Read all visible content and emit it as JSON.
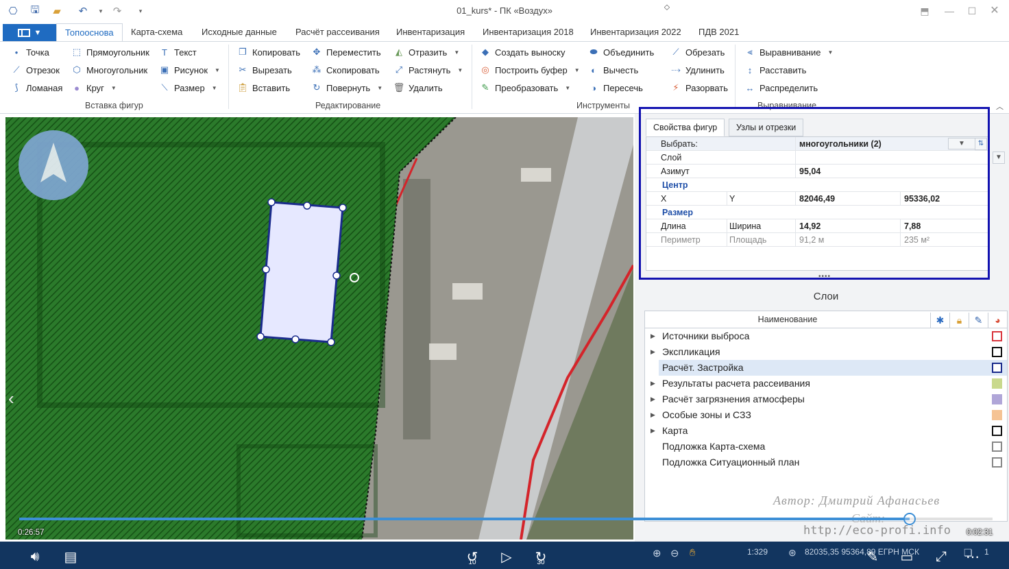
{
  "window": {
    "title": "01_kurs* - ПК «Воздух»",
    "quick_access": [
      "app-icon",
      "save-icon",
      "open-folder-icon",
      "undo-icon",
      "redo-icon",
      "customize-icon"
    ],
    "controls": [
      "ribbon-options-icon",
      "minimize-icon",
      "maximize-icon",
      "close-icon"
    ]
  },
  "tabs": [
    "Топооснова",
    "Карта-схема",
    "Исходные данные",
    "Расчёт рассеивания",
    "Инвентаризация",
    "Инвентаризация 2018",
    "Инвентаризация 2022",
    "ПДВ 2021"
  ],
  "ribbon": {
    "insert": {
      "label": "Вставка фигур",
      "point": "Точка",
      "segment": "Отрезок",
      "polyline": "Ломаная",
      "rectangle": "Прямоугольник",
      "polygon": "Многоугольник",
      "circle": "Круг",
      "text": "Текст",
      "picture": "Рисунок",
      "size": "Размер"
    },
    "edit": {
      "label": "Редактирование",
      "copy": "Копировать",
      "cut": "Вырезать",
      "paste": "Вставить",
      "move": "Переместить",
      "duplicate": "Скопировать",
      "rotate": "Повернуть",
      "mirror": "Отразить",
      "stretch": "Растянуть",
      "delete": "Удалить"
    },
    "tools": {
      "label": "Инструменты",
      "callout": "Создать выноску",
      "buffer": "Построить буфер",
      "convert": "Преобразовать",
      "union": "Объединить",
      "subtract": "Вычесть",
      "intersect": "Пересечь",
      "trim": "Обрезать",
      "extend": "Удлинить",
      "break": "Разорвать"
    },
    "align": {
      "label": "Выравнивание",
      "align": "Выравнивание",
      "arrange": "Расставить",
      "distribute": "Распределить"
    }
  },
  "properties": {
    "tab_shape": "Свойства фигур",
    "tab_nodes": "Узлы и отрезки",
    "select_label": "Выбрать:",
    "select_value": "многоугольники (2)",
    "layer_label": "Слой",
    "layer_value": "",
    "azimuth_label": "Азимут",
    "azimuth_value": "95,04",
    "center_section": "Центр",
    "x_label": "X",
    "y_label": "Y",
    "x_value": "82046,49",
    "y_value": "95336,02",
    "size_section": "Размер",
    "length_label": "Длина",
    "width_label": "Ширина",
    "length_value": "14,92",
    "width_value": "7,88",
    "perimeter_label": "Периметр",
    "area_label": "Площадь",
    "perimeter_value": "91,2 м",
    "area_value": "235 м²"
  },
  "layers": {
    "title": "Слои",
    "column_name": "Наименование",
    "header_icons": [
      "visibility-icon",
      "lock-icon",
      "edit-icon",
      "color-icon"
    ],
    "items": [
      {
        "name": "Источники выброса",
        "expandable": true,
        "selected": false,
        "color": "#d9363e",
        "fill": "#ffffff"
      },
      {
        "name": "Экспликация",
        "expandable": true,
        "selected": false,
        "color": "#111111",
        "fill": "#ffffff"
      },
      {
        "name": "Расчёт. Застройка",
        "expandable": false,
        "selected": true,
        "color": "#1a2b8c",
        "fill": "#ffffff"
      },
      {
        "name": "Результаты расчета рассеивания",
        "expandable": true,
        "selected": false,
        "color": "#c9d98d",
        "fill": "#c9d98d"
      },
      {
        "name": "Расчёт загрязнения атмосферы",
        "expandable": true,
        "selected": false,
        "color": "#b0a6d8",
        "fill": "#b0a6d8"
      },
      {
        "name": "Особые зоны и СЗЗ",
        "expandable": true,
        "selected": false,
        "color": "#f5c394",
        "fill": "#f5c394"
      },
      {
        "name": "Карта",
        "expandable": true,
        "selected": false,
        "color": "#111111",
        "fill": "#ffffff"
      },
      {
        "name": "Подложка Карта-схема",
        "expandable": false,
        "selected": false,
        "color": "#888888",
        "fill": "#ffffff"
      },
      {
        "name": "Подложка Ситуационный план",
        "expandable": false,
        "selected": false,
        "color": "#888888",
        "fill": "#ffffff"
      }
    ]
  },
  "watermark": {
    "author": "Автор: Дмитрий Афанасьев",
    "site_label": "Сайт:",
    "url": "http://eco-profi.info"
  },
  "player": {
    "elapsed": "0:26:57",
    "remaining": "0:02:31",
    "progress": 0.915,
    "rewind_seconds": "10",
    "forward_seconds": "30"
  },
  "statusbar": {
    "scale": "1:329",
    "coords": "82035,35 95364,89 ЕГРН МСК",
    "count": "1"
  },
  "colors": {
    "accent": "#1f6bc1",
    "highlight_frame": "#1111b0",
    "selected_shape_fill": "#e6e8ff",
    "selected_shape_stroke": "#1a2b8c",
    "zone_hatch": "#1f6a1f",
    "status_bar": "#12355f",
    "progress": "#3d8fd6"
  }
}
